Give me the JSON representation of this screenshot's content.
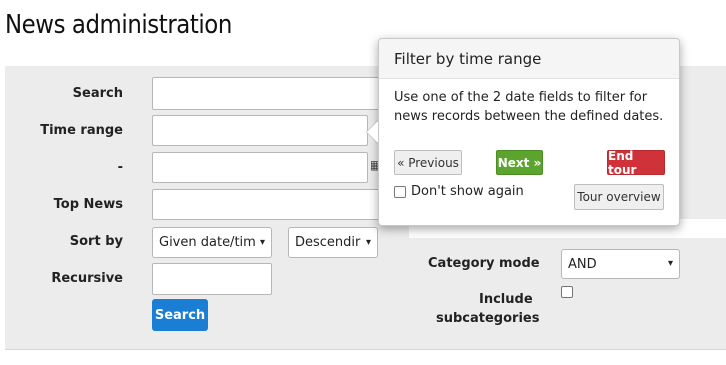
{
  "page": {
    "title": "News administration"
  },
  "form": {
    "search_label": "Search",
    "time_range_label": "Time range",
    "dash_label": "-",
    "top_news_label": "Top News",
    "sort_by_label": "Sort by",
    "sort_field_value": "Given date/tim",
    "sort_order_value": "Descendir",
    "recursive_label": "Recursive",
    "search_button": "Search",
    "category_mode_label": "Category mode",
    "category_mode_value": "AND",
    "include_sub_label_1": "Include",
    "include_sub_label_2": "subcategories"
  },
  "popover": {
    "title": "Filter by time range",
    "body": "Use one of the 2 date fields to filter for news records between the defined dates.",
    "previous": "« Previous",
    "next": "Next »",
    "end_tour": "End tour",
    "dont_show": "Don't show again",
    "tour_overview": "Tour overview"
  },
  "icons": {
    "chevron": "chevron-down-icon",
    "calendar": "calendar-icon"
  },
  "colors": {
    "primary": "#1a7fd4",
    "next": "#5ba52e",
    "end": "#d0323a"
  }
}
